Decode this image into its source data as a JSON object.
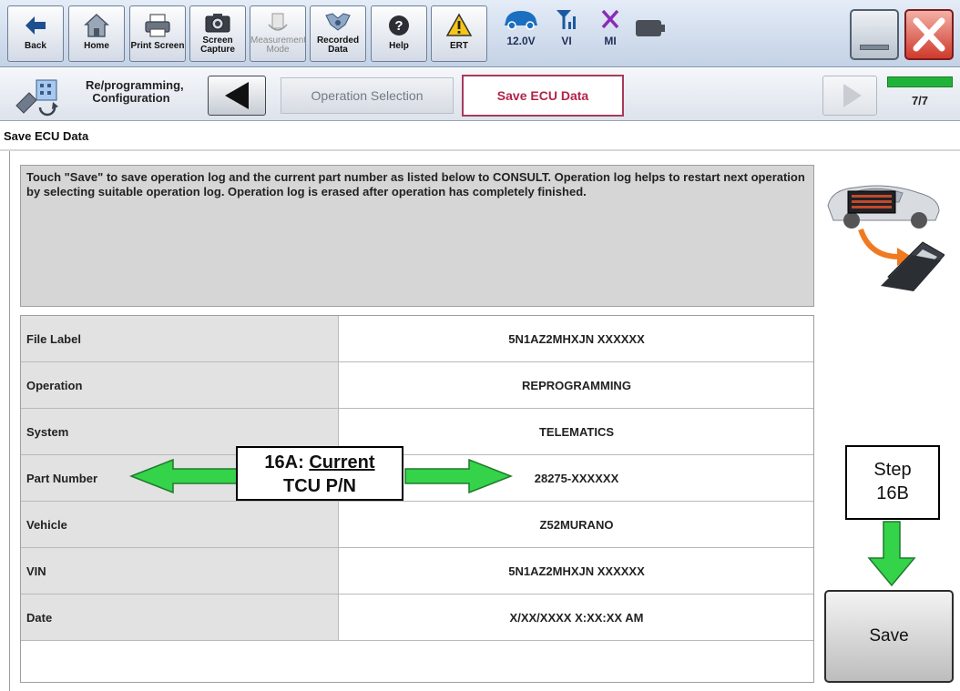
{
  "toolbar": {
    "back": "Back",
    "home": "Home",
    "print_screen": "Print Screen",
    "screen_capture_1": "Screen",
    "screen_capture_2": "Capture",
    "measurement_1": "Measurement",
    "measurement_2": "Mode",
    "recorded_1": "Recorded",
    "recorded_2": "Data",
    "help": "Help",
    "ert": "ERT",
    "battery": "12.0V",
    "vi": "VI",
    "mi": "MI"
  },
  "nav": {
    "crumb_1": "Re/programming,",
    "crumb_2": "Configuration",
    "step_previous": "Operation Selection",
    "step_current": "Save ECU Data",
    "progress": "7/7",
    "progress_fraction": 1.0
  },
  "page": {
    "title": "Save ECU Data",
    "instructions": "Touch \"Save\" to save operation log and the current part number as listed below to CONSULT. Operation log helps to restart next operation by selecting suitable operation log. Operation log is erased after operation has completely finished."
  },
  "table": {
    "rows": [
      {
        "label": "File Label",
        "value": "5N1AZ2MHXJN XXXXXX"
      },
      {
        "label": "Operation",
        "value": "REPROGRAMMING"
      },
      {
        "label": "System",
        "value": "TELEMATICS"
      },
      {
        "label": "Part Number",
        "value": "28275-XXXXXX"
      },
      {
        "label": "Vehicle",
        "value": "Z52MURANO"
      },
      {
        "label": "VIN",
        "value": "5N1AZ2MHXJN XXXXXX"
      },
      {
        "label": "Date",
        "value": "X/XX/XXXX X:XX:XX AM"
      },
      {
        "label": "",
        "value": ""
      }
    ]
  },
  "annotations": {
    "callout_16a_line1_prefix": "16A: ",
    "callout_16a_line1_underlined": "Current",
    "callout_16a_line2": "TCU P/N",
    "callout_16b_line1": "Step",
    "callout_16b_line2": "16B"
  },
  "actions": {
    "save": "Save"
  },
  "colors": {
    "accent_green": "#34d34a",
    "current_step_text": "#b4234a",
    "progress_green": "#1fb33a"
  }
}
